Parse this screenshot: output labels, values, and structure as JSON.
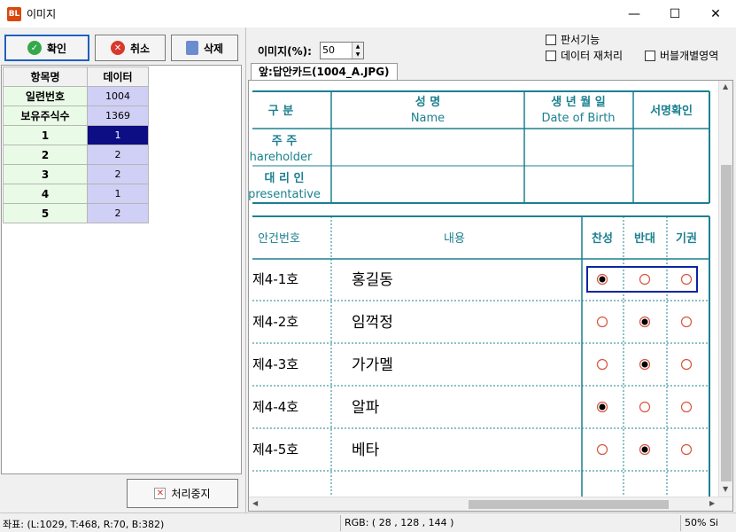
{
  "window": {
    "title": "이미지",
    "app_icon_text": "BL",
    "minimize": "—",
    "maximize": "☐",
    "close": "✕"
  },
  "toolbar": {
    "confirm_label": "확인",
    "cancel_label": "취소",
    "delete_label": "삭제"
  },
  "grid": {
    "headers": [
      "항목명",
      "데이터"
    ],
    "rows": [
      {
        "key": "일련번호",
        "value": "1004"
      },
      {
        "key": "보유주식수",
        "value": "1369"
      },
      {
        "key": "1",
        "value": "1"
      },
      {
        "key": "2",
        "value": "2"
      },
      {
        "key": "3",
        "value": "2"
      },
      {
        "key": "4",
        "value": "1"
      },
      {
        "key": "5",
        "value": "2"
      }
    ]
  },
  "stop_button": {
    "label": "처리중지"
  },
  "zoom": {
    "label": "이미지(%):",
    "value": "50"
  },
  "options": {
    "handwriting": "판서기능",
    "reprocess": "데이터 재처리",
    "bubble_area": "버블개별영역"
  },
  "tab": {
    "label": "앞:답안카드(1004_A.JPG)"
  },
  "sheet": {
    "top_headers": {
      "col1": "구 분",
      "name_kr": "성 명",
      "name_en": "Name",
      "dob_kr": "생 년 월 일",
      "dob_en": "Date of Birth",
      "sign": "서명확인"
    },
    "row_shareholder": {
      "kr": "주 주",
      "en": "hareholder"
    },
    "row_rep": {
      "kr": "대 리 인",
      "en": "presentative"
    },
    "vote_headers": {
      "no": "안건번호",
      "content": "내용",
      "yes": "찬성",
      "no_vote": "반대",
      "abstain": "기권"
    },
    "items": [
      {
        "no": "제4-1호",
        "name": "홍길동",
        "mark": 0
      },
      {
        "no": "제4-2호",
        "name": "임꺽정",
        "mark": 1
      },
      {
        "no": "제4-3호",
        "name": "가가멜",
        "mark": 1
      },
      {
        "no": "제4-4호",
        "name": "알파",
        "mark": 0
      },
      {
        "no": "제4-5호",
        "name": "베타",
        "mark": 1
      }
    ]
  },
  "status": {
    "coords": "좌표: (L:1029, T:468, R:70, B:382)",
    "rgb": "RGB: ( 28 , 128 , 144 )",
    "zoom": "50% Si"
  },
  "colors": {
    "teal": "#1c8090",
    "selection": "#0d0d84",
    "bubble": "#d9553f"
  }
}
